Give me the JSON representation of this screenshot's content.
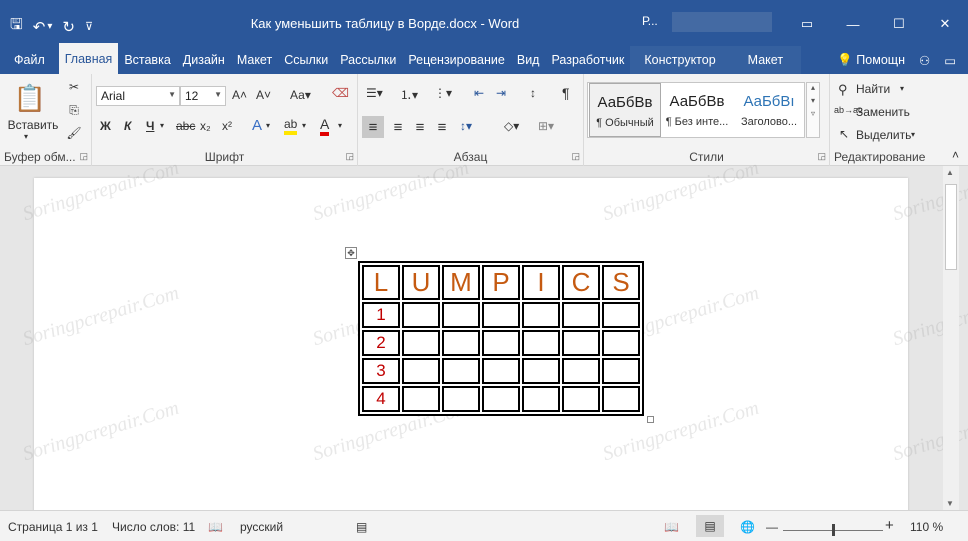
{
  "window": {
    "title": "Как уменьшить таблицу в Ворде.docx - Word",
    "account_initial": "Р...",
    "min": "—",
    "max": "☐",
    "close": "✕",
    "ribbon_display": "▭"
  },
  "qat": {
    "save": "🖫",
    "undo": "↶",
    "undo_arrow": "▾",
    "redo": "↻",
    "customize": "⊽"
  },
  "tabs": {
    "file": "Файл",
    "home": "Главная",
    "insert": "Вставка",
    "design": "Дизайн",
    "layout": "Макет",
    "references": "Ссылки",
    "mailings": "Рассылки",
    "review": "Рецензирование",
    "view": "Вид",
    "developer": "Разработчик",
    "table_design": "Конструктор",
    "table_layout": "Макет",
    "tell_me": "Помощн",
    "share": "⚇",
    "comment": "▭"
  },
  "ribbon": {
    "clipboard": {
      "paste": "Вставить",
      "paste_arrow": "▾",
      "label": "Буфер обм...",
      "cut": "✂",
      "copy": "⎘",
      "format_painter": "🖌"
    },
    "font": {
      "name": "Arial",
      "size": "12",
      "grow": "A˄",
      "shrink": "A˅",
      "case": "Аа▾",
      "clear": "⌫",
      "bold": "Ж",
      "italic": "К",
      "underline": "Ч",
      "underline_arrow": "▾",
      "strike": "abc",
      "sub": "x₂",
      "sup": "x²",
      "effects": "A",
      "effects_arrow": "▾",
      "highlight": "ab",
      "highlight_arrow": "▾",
      "color": "A",
      "color_arrow": "▾",
      "label": "Шрифт"
    },
    "paragraph": {
      "bullets": "☰▾",
      "numbering": "⒈▾",
      "multilevel": "⋮▾",
      "dec_indent": "⇤",
      "inc_indent": "⇥",
      "sort": "↕",
      "show_marks": "¶",
      "align_left": "≡",
      "align_center": "≡",
      "align_right": "≡",
      "justify": "≡",
      "line_spacing": "↕▾",
      "shading": "◇▾",
      "borders": "⊞▾",
      "label": "Абзац"
    },
    "styles": {
      "items": [
        {
          "preview": "АаБбВв",
          "name": "¶ Обычный"
        },
        {
          "preview": "АаБбВв",
          "name": "¶ Без инте..."
        },
        {
          "preview": "АаБбВı",
          "name": "Заголово..."
        }
      ],
      "scroll_up": "▴",
      "scroll_down": "▾",
      "more": "▿",
      "label": "Стили"
    },
    "editing": {
      "find": "Найти",
      "find_arrow": "▾",
      "replace": "Заменить",
      "select": "Выделить",
      "select_arrow": "▾",
      "label": "Редактирование",
      "collapse": "˄",
      "find_icon": "⚲",
      "replace_icon": "ab→ac",
      "select_icon": "↖"
    },
    "launcher": "◲"
  },
  "table": {
    "header": [
      "L",
      "U",
      "M",
      "P",
      "I",
      "C",
      "S"
    ],
    "rows": [
      [
        "1",
        "",
        "",
        "",
        "",
        "",
        ""
      ],
      [
        "2",
        "",
        "",
        "",
        "",
        "",
        ""
      ],
      [
        "3",
        "",
        "",
        "",
        "",
        "",
        ""
      ],
      [
        "4",
        "",
        "",
        "",
        "",
        "",
        ""
      ]
    ],
    "move_handle": "✥"
  },
  "watermark": "Soringpcrepair.Com",
  "statusbar": {
    "page": "Страница 1 из 1",
    "words": "Число слов: 11",
    "proofing_icon": "📖",
    "language": "русский",
    "macro_icon": "▤",
    "read_mode": "📖",
    "print_layout": "▤",
    "web_layout": "🌐",
    "zoom_out": "—",
    "zoom_in": "+",
    "zoom": "110 %"
  },
  "scrollbar": {
    "up": "▲",
    "down": "▼"
  }
}
